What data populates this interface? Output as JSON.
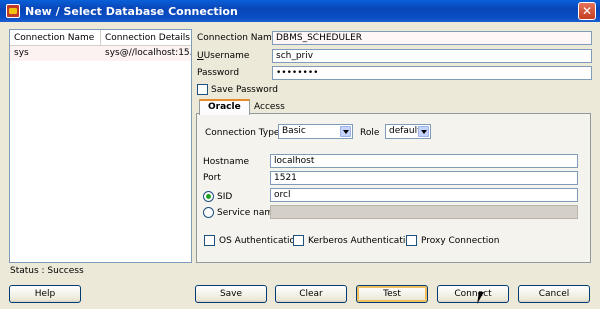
{
  "window": {
    "title": "New / Select Database Connection",
    "close_glyph": "✕"
  },
  "connections": {
    "columns": [
      "Connection Name",
      "Connection Details"
    ],
    "rows": [
      {
        "name": "sys",
        "details": "sys@//localhost:15..."
      }
    ]
  },
  "form": {
    "connection_name_label": "Connection Name",
    "connection_name": "DBMS_SCHEDULER",
    "username_label": "Username",
    "username": "sch_priv",
    "password_label": "Password",
    "password": "••••••••",
    "save_password_label": "Save Password"
  },
  "tabs": [
    {
      "label": "Oracle"
    },
    {
      "label": "Access"
    }
  ],
  "oracle": {
    "connection_type_label": "Connection Type",
    "connection_type": "Basic",
    "role_label": "Role",
    "role": "default",
    "hostname_label": "Hostname",
    "hostname": "localhost",
    "port_label": "Port",
    "port": "1521",
    "sid_label": "SID",
    "sid": "orcl",
    "service_name_label": "Service name",
    "service_name": "",
    "os_auth_label": "OS Authentication",
    "kerberos_auth_label": "Kerberos Authentication",
    "proxy_label": "Proxy Connection"
  },
  "status": "Status : Success",
  "buttons": {
    "help": "Help",
    "save": "Save",
    "clear": "Clear",
    "test": "Test",
    "connect": "Connect",
    "cancel": "Cancel"
  }
}
